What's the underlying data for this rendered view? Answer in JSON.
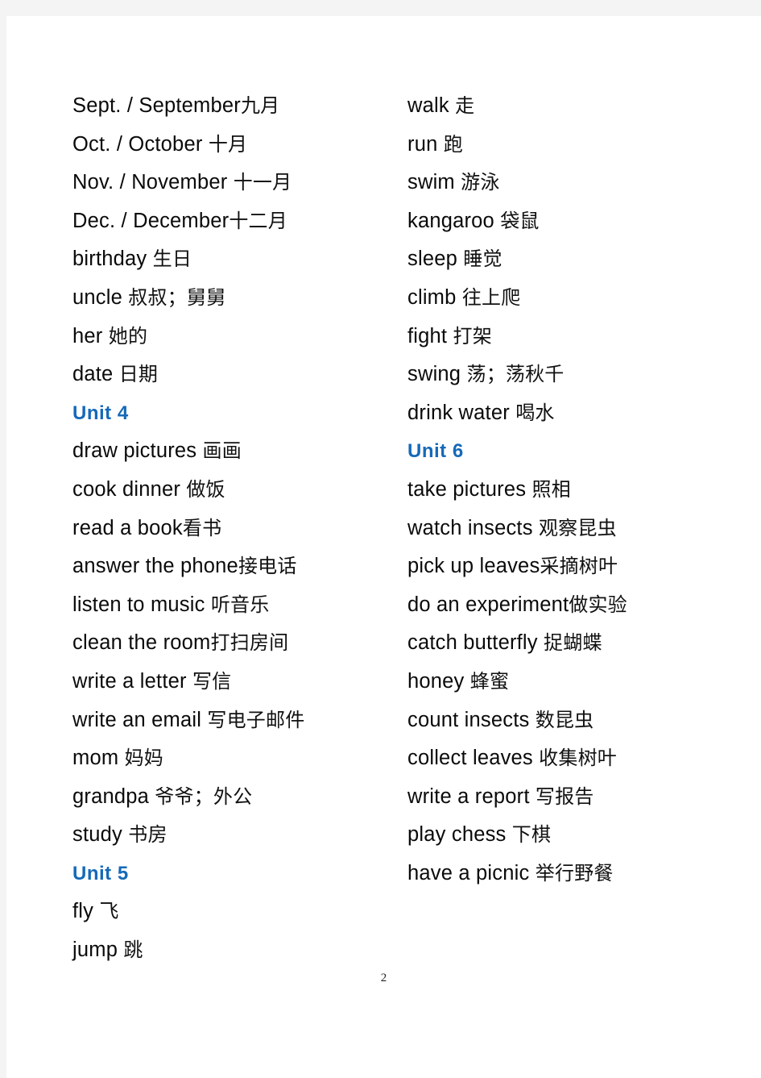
{
  "document": {
    "page_number": "2",
    "accent_color": "#1569b8",
    "text_color": "#000000",
    "background_color": "#ffffff",
    "margin_strip_color": "#f4f4f4"
  },
  "columns": [
    {
      "id": "left-column",
      "entries": [
        {
          "type": "word",
          "en": "Sept. / September",
          "zh": "九月",
          "gap": false
        },
        {
          "type": "word",
          "en": "Oct. / October",
          "zh": "十月",
          "gap": true
        },
        {
          "type": "word",
          "en": "Nov. / November",
          "zh": "十一月",
          "gap": true
        },
        {
          "type": "word",
          "en": "Dec. / December",
          "zh": "十二月",
          "gap": false
        },
        {
          "type": "word",
          "en": "birthday",
          "zh": "生日",
          "gap": true
        },
        {
          "type": "word",
          "en": "uncle",
          "zh": "叔叔；舅舅",
          "gap": true
        },
        {
          "type": "word",
          "en": "her",
          "zh": "她的",
          "gap": true
        },
        {
          "type": "word",
          "en": "date",
          "zh": "日期",
          "gap": true
        },
        {
          "type": "heading",
          "en": "Unit 4",
          "zh": "",
          "gap": false
        },
        {
          "type": "word",
          "en": "draw pictures",
          "zh": "画画",
          "gap": true
        },
        {
          "type": "word",
          "en": "cook dinner",
          "zh": "做饭",
          "gap": true
        },
        {
          "type": "word",
          "en": "read a book",
          "zh": "看书",
          "gap": false
        },
        {
          "type": "word",
          "en": "answer the phone",
          "zh": "接电话",
          "gap": false
        },
        {
          "type": "word",
          "en": "listen to music",
          "zh": "听音乐",
          "gap": true
        },
        {
          "type": "word",
          "en": "clean the room",
          "zh": "打扫房间",
          "gap": false
        },
        {
          "type": "word",
          "en": "write a letter",
          "zh": "写信",
          "gap": true
        },
        {
          "type": "word",
          "en": "write an email",
          "zh": "写电子邮件",
          "gap": true
        },
        {
          "type": "word",
          "en": "mom",
          "zh": "妈妈",
          "gap": true
        },
        {
          "type": "word",
          "en": "grandpa",
          "zh": "爷爷；外公",
          "gap": true
        },
        {
          "type": "word",
          "en": "study",
          "zh": "书房",
          "gap": true
        },
        {
          "type": "heading",
          "en": "Unit 5",
          "zh": "",
          "gap": false
        },
        {
          "type": "word",
          "en": "fly",
          "zh": "飞",
          "gap": true
        },
        {
          "type": "word",
          "en": "jump",
          "zh": "跳",
          "gap": true
        }
      ]
    },
    {
      "id": "right-column",
      "entries": [
        {
          "type": "word",
          "en": "walk",
          "zh": "走",
          "gap": true
        },
        {
          "type": "word",
          "en": "run",
          "zh": "跑",
          "gap": true
        },
        {
          "type": "word",
          "en": "swim",
          "zh": "游泳",
          "gap": true
        },
        {
          "type": "word",
          "en": "kangaroo",
          "zh": "袋鼠",
          "gap": true
        },
        {
          "type": "word",
          "en": "sleep",
          "zh": "睡觉",
          "gap": true
        },
        {
          "type": "word",
          "en": "climb",
          "zh": "往上爬",
          "gap": true
        },
        {
          "type": "word",
          "en": "fight",
          "zh": "打架",
          "gap": true
        },
        {
          "type": "word",
          "en": "swing",
          "zh": "荡；荡秋千",
          "gap": true
        },
        {
          "type": "word",
          "en": "drink water",
          "zh": "喝水",
          "gap": true
        },
        {
          "type": "heading",
          "en": "Unit 6",
          "zh": "",
          "gap": false
        },
        {
          "type": "word",
          "en": "take pictures",
          "zh": "照相",
          "gap": true
        },
        {
          "type": "word",
          "en": "watch insects",
          "zh": "观察昆虫",
          "gap": true
        },
        {
          "type": "word",
          "en": "pick up leaves",
          "zh": "采摘树叶",
          "gap": false
        },
        {
          "type": "word",
          "en": "do an experiment",
          "zh": "做实验",
          "gap": false
        },
        {
          "type": "word",
          "en": "catch butterfly",
          "zh": "捉蝴蝶",
          "gap": true
        },
        {
          "type": "word",
          "en": "honey",
          "zh": "蜂蜜",
          "gap": true
        },
        {
          "type": "word",
          "en": "count insects",
          "zh": "数昆虫",
          "gap": true
        },
        {
          "type": "word",
          "en": "collect leaves",
          "zh": "收集树叶",
          "gap": true
        },
        {
          "type": "word",
          "en": "write a report",
          "zh": "写报告",
          "gap": true
        },
        {
          "type": "word",
          "en": "play chess",
          "zh": "下棋",
          "gap": true
        },
        {
          "type": "word",
          "en": "have a picnic",
          "zh": "举行野餐",
          "gap": true
        }
      ]
    }
  ]
}
